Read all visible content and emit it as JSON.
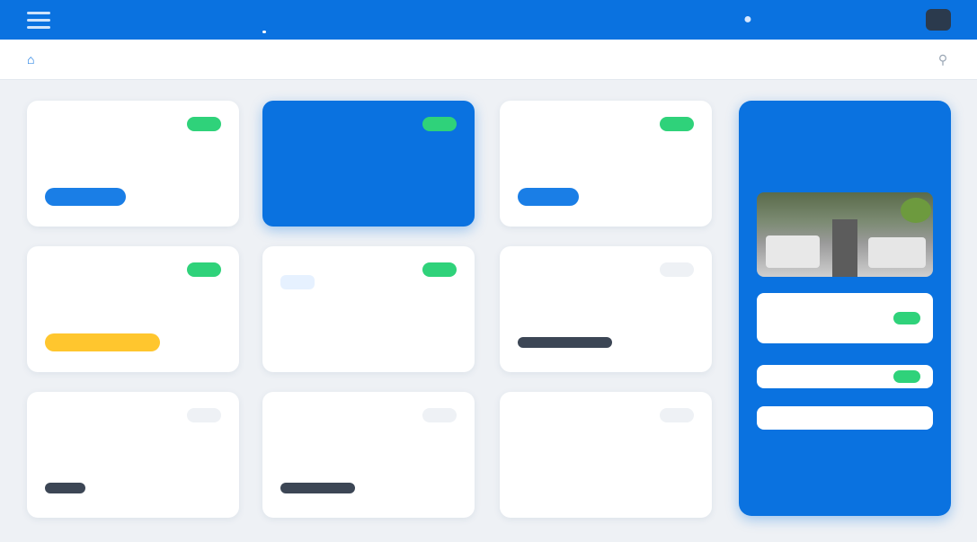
{
  "topbar": {
    "nav": [
      "",
      "",
      ""
    ],
    "user": "",
    "icons": {
      "menu": "menu-icon",
      "notification": "bell-icon"
    }
  },
  "subbar": {
    "links": [
      "",
      "",
      "",
      ""
    ],
    "icons": {
      "home": "home-icon",
      "search": "search-icon"
    }
  },
  "cards": [
    {
      "num": "",
      "title": "",
      "sub": "",
      "badge": "",
      "bar_label": "",
      "progress": 0.6
    },
    {
      "num": "",
      "title": "",
      "desc": "",
      "badge": ""
    },
    {
      "num": "",
      "title": "",
      "sub": "",
      "badge": "",
      "bar_label": "",
      "progress": 0.45
    },
    {
      "num": "",
      "title": "",
      "sub": "",
      "badge": "",
      "bar_label": "",
      "progress": 0.85
    },
    {
      "num": "",
      "title": "",
      "tag": "",
      "badge": ""
    },
    {
      "num": "",
      "title": "",
      "sub": "",
      "badge": "",
      "bar_label": "",
      "progress": 0.7
    },
    {
      "num": "",
      "title": "",
      "sub": "",
      "badge": "",
      "bar_label": "",
      "progress": 0.3
    },
    {
      "num": "",
      "title": "",
      "sub": "",
      "badge": "",
      "bar_label": "",
      "progress": 0.55
    },
    {
      "num": "",
      "title": "",
      "sub": "",
      "badge": ""
    }
  ],
  "panel": {
    "num": "",
    "title": "",
    "box1": {
      "line1": "",
      "line2": ""
    },
    "box2": {
      "line1": ""
    },
    "box3": {
      "line1": ""
    }
  },
  "colors": {
    "primary": "#0a72e0",
    "success": "#2fd27a",
    "warning": "#ffc62e",
    "dark": "#3c4655"
  }
}
